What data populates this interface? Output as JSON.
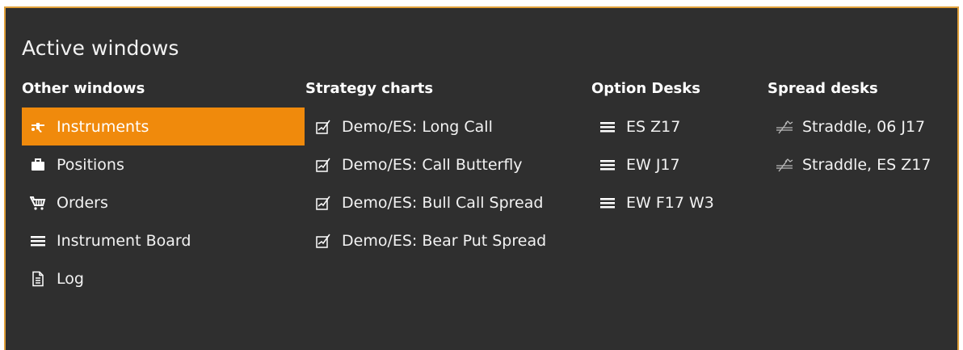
{
  "panel": {
    "title": "Active windows"
  },
  "columns": {
    "other": {
      "header": "Other windows",
      "items": [
        {
          "label": "Instruments",
          "icon": "instruments-icon",
          "selected": true
        },
        {
          "label": "Positions",
          "icon": "briefcase-icon"
        },
        {
          "label": "Orders",
          "icon": "cart-icon"
        },
        {
          "label": "Instrument Board",
          "icon": "list-icon"
        },
        {
          "label": "Log",
          "icon": "document-icon"
        }
      ]
    },
    "strategy": {
      "header": "Strategy charts",
      "items": [
        {
          "label": "Demo/ES: Long Call",
          "icon": "chart-icon"
        },
        {
          "label": "Demo/ES: Call Butterfly",
          "icon": "chart-icon"
        },
        {
          "label": "Demo/ES: Bull Call Spread",
          "icon": "chart-icon"
        },
        {
          "label": "Demo/ES: Bear Put Spread",
          "icon": "chart-icon"
        }
      ]
    },
    "option": {
      "header": "Option Desks",
      "items": [
        {
          "label": "ES Z17",
          "icon": "list-icon"
        },
        {
          "label": "EW J17",
          "icon": "list-icon"
        },
        {
          "label": "EW F17 W3",
          "icon": "list-icon"
        }
      ]
    },
    "spread": {
      "header": "Spread desks",
      "items": [
        {
          "label": "Straddle, 06 J17",
          "icon": "spread-icon"
        },
        {
          "label": "Straddle, ES Z17",
          "icon": "spread-icon"
        }
      ]
    }
  },
  "colors": {
    "background": "#2f2f2f",
    "border": "#e0a03a",
    "selected": "#f08a0c",
    "text": "#f2f2f2"
  }
}
